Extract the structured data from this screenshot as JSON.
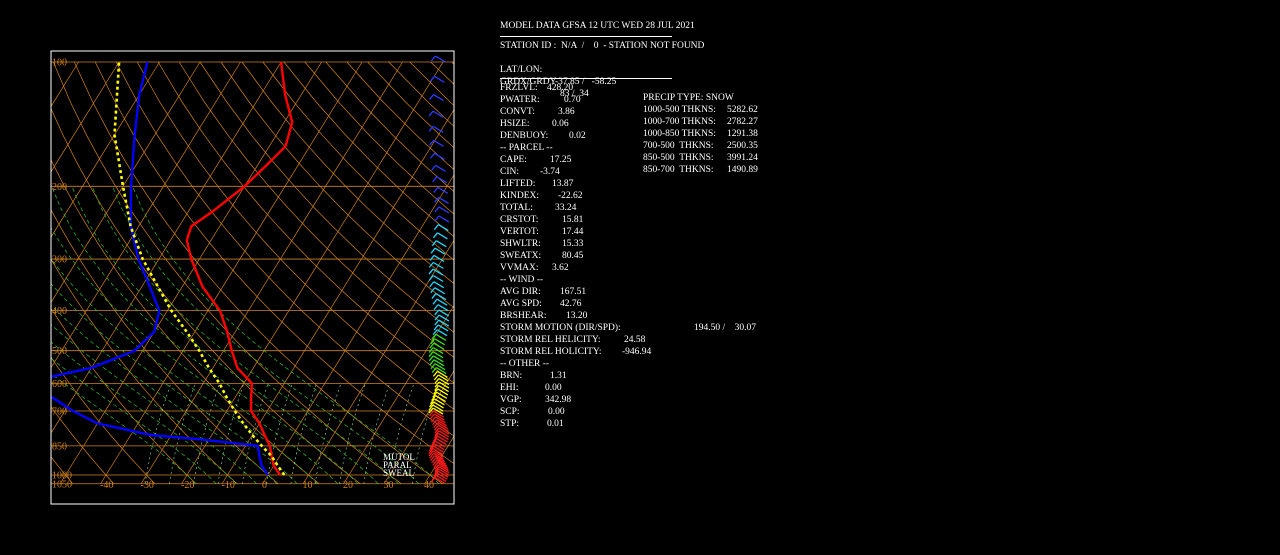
{
  "header": {
    "title": "MODEL DATA GFSA 12 UTC WED 28 JUL 2021",
    "station": "STATION ID :  N/A  /    0  - STATION NOT FOUND",
    "latlon_label": "LAT/LON:",
    "latlon_value": "-37.85 /   -58.25",
    "grd_label": "GRDX/GRDY",
    "grd_value": "83 /  34"
  },
  "indices_left": [
    {
      "label": "FRZLVL:",
      "value": "428.20"
    },
    {
      "label": "PWATER:",
      "value": "0.70"
    },
    {
      "label": "CONVT:",
      "value": "3.86"
    },
    {
      "label": "HSIZE:",
      "value": "0.06"
    },
    {
      "label": "DENBUOY:",
      "value": "0.02"
    },
    {
      "label": "-- PARCEL --",
      "value": ""
    },
    {
      "label": "CAPE:",
      "value": "17.25"
    },
    {
      "label": "CIN:",
      "value": "-3.74"
    },
    {
      "label": "LIFTED:",
      "value": "13.87"
    },
    {
      "label": "KINDEX:",
      "value": "-22.62"
    },
    {
      "label": "TOTAL:",
      "value": "33.24"
    },
    {
      "label": "CRSTOT:",
      "value": "15.81"
    },
    {
      "label": "VERTOT:",
      "value": "17.44"
    },
    {
      "label": "SHWLTR:",
      "value": "15.33"
    },
    {
      "label": "SWEATX:",
      "value": "80.45"
    },
    {
      "label": "VVMAX:",
      "value": "3.62"
    },
    {
      "label": "-- WIND --",
      "value": ""
    },
    {
      "label": "AVG DIR:",
      "value": "167.51"
    },
    {
      "label": "AVG SPD:",
      "value": "42.76"
    },
    {
      "label": "BRSHEAR:",
      "value": "13.20"
    },
    {
      "label": "STORM MOTION (DIR/SPD):",
      "value": "194.50 /    30.07"
    },
    {
      "label": "STORM REL HELICITY:",
      "value": "24.58"
    },
    {
      "label": "STORM REL HOLICITY:",
      "value": "-946.94"
    },
    {
      "label": "-- OTHER --",
      "value": ""
    },
    {
      "label": "BRN:",
      "value": "1.31"
    },
    {
      "label": "EHI:",
      "value": "0.00"
    },
    {
      "label": "VGP:",
      "value": "342.98"
    },
    {
      "label": "SCP:",
      "value": "0.00"
    },
    {
      "label": "STP:",
      "value": "0.01"
    }
  ],
  "indices_right": [
    {
      "label": "PRECIP TYPE: SNOW",
      "value": ""
    },
    {
      "label": "1000-500 THKNS:",
      "value": "5282.62"
    },
    {
      "label": "1000-700 THKNS:",
      "value": "2782.27"
    },
    {
      "label": "1000-850 THKNS:",
      "value": "1291.38"
    },
    {
      "label": "700-500  THKNS:",
      "value": "2500.35"
    },
    {
      "label": "850-500  THKNS:",
      "value": "3991.24"
    },
    {
      "label": "850-700  THKNS:",
      "value": "1490.89"
    }
  ],
  "chart_data": {
    "type": "line",
    "subtype": "skew-T log-P",
    "pressure_levels": [
      "100",
      "200",
      "300",
      "400",
      "500",
      "600",
      "700",
      "850",
      "1000",
      "1050"
    ],
    "temperature_ticks": [
      "-40",
      "-30",
      "-20",
      "-10",
      "0",
      "10",
      "20",
      "30",
      "40"
    ],
    "series": [
      {
        "key": "temperature",
        "color": "#ff0000",
        "p": [
          1000,
          950,
          900,
          850,
          800,
          750,
          700,
          650,
          600,
          550,
          500,
          450,
          400,
          350,
          300,
          270,
          250,
          230,
          200,
          180,
          160,
          140,
          120,
          100
        ],
        "t": [
          3,
          0,
          -2,
          -4,
          -7,
          -10,
          -14,
          -16,
          -18,
          -24,
          -28,
          -32,
          -37,
          -45,
          -52,
          -56,
          -57,
          -54,
          -50,
          -48,
          -46,
          -48,
          -54,
          -60
        ]
      },
      {
        "key": "dewpoint",
        "color": "#0000ff",
        "p": [
          1000,
          950,
          900,
          850,
          820,
          800,
          750,
          700,
          650,
          620,
          600,
          550,
          500,
          450,
          400,
          350,
          300,
          250,
          200,
          150,
          120,
          100
        ],
        "t": [
          0,
          -3,
          -5,
          -7,
          -22,
          -35,
          -50,
          -58,
          -65,
          -72,
          -75,
          -60,
          -52,
          -50,
          -52,
          -58,
          -65,
          -72,
          -78,
          -85,
          -90,
          -93
        ]
      },
      {
        "key": "parcel",
        "color": "#ffff00",
        "p": [
          1000,
          950,
          900,
          850,
          800,
          750,
          700,
          650,
          600,
          550,
          500,
          450,
          400,
          350,
          300,
          250,
          200,
          150,
          100
        ],
        "t": [
          4,
          1,
          -2,
          -6,
          -10,
          -14,
          -18,
          -22,
          -26,
          -31,
          -36,
          -42,
          -49,
          -56,
          -64,
          -72,
          -80,
          -90,
          -100
        ]
      }
    ],
    "legend_labels": [
      "MUTOL",
      "PARAL",
      "SWEAL"
    ]
  }
}
